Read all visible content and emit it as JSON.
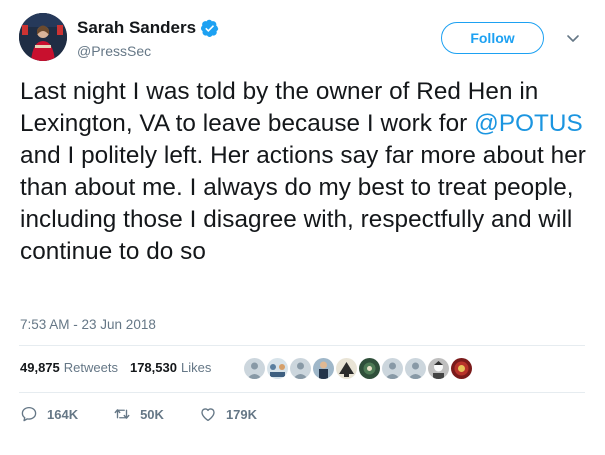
{
  "user": {
    "name": "Sarah Sanders",
    "handle": "@PressSec"
  },
  "follow_label": "Follow",
  "tweet": {
    "text_before": "Last night I was told by the owner of Red Hen in Lexington, VA to leave because I work for ",
    "mention": "@POTUS",
    "text_after": " and I politely left. Her actions say far more about her than about me. I always do my best to treat people, including those I disagree with, respectfully and will continue to do so",
    "timestamp": "7:53 AM - 23 Jun 2018"
  },
  "stats": {
    "retweets_count": "49,875",
    "retweets_label": "Retweets",
    "likes_count": "178,530",
    "likes_label": "Likes"
  },
  "actions": {
    "replies": "164K",
    "retweets": "50K",
    "likes": "179K"
  },
  "colors": {
    "brand_blue": "#1da1f2",
    "link_blue": "#1b95e0",
    "muted": "#657786",
    "text": "#14171a"
  }
}
